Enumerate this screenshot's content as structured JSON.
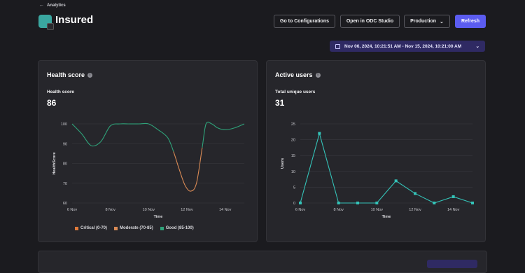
{
  "breadcrumb": {
    "label": "Analytics"
  },
  "header": {
    "title": "Insured",
    "buttons": {
      "configurations": "Go to Configurations",
      "odc_studio": "Open in ODC Studio",
      "environment": "Production",
      "refresh": "Refresh"
    }
  },
  "date_range": "Nov 06, 2024, 10:21:51 AM - Nov 15, 2024, 10:21:00 AM",
  "colors": {
    "accent": "#5b5cf0",
    "good": "#2fa37a",
    "moderate": "#d98a55",
    "critical": "#e07a3a",
    "users_line": "#34c3b8"
  },
  "health_card": {
    "title": "Health score",
    "metric_label": "Health score",
    "metric_value": "86",
    "y_axis_label": "HealthScore",
    "x_axis_label": "Time",
    "legend": [
      "Critical (0-70)",
      "Moderate (70-85)",
      "Good (85-100)"
    ]
  },
  "users_card": {
    "title": "Active users",
    "metric_label": "Total unique users",
    "metric_value": "31",
    "y_axis_label": "Users",
    "x_axis_label": "Time"
  },
  "chart_data": [
    {
      "type": "line",
      "y_ticks": [
        "100",
        "90",
        "80",
        "70",
        "60"
      ],
      "x_ticks": [
        "6 Nov",
        "8 Nov",
        "10 Nov",
        "12 Nov",
        "14 Nov"
      ],
      "ylim": [
        60,
        100
      ],
      "x": [
        6.0,
        6.5,
        7.0,
        7.5,
        8.0,
        8.5,
        9.0,
        9.5,
        10.0,
        10.5,
        11.0,
        11.3,
        11.6,
        11.9,
        12.2,
        12.5,
        12.8,
        13.0,
        13.3,
        13.6,
        14.0,
        14.5,
        15.0
      ],
      "values": [
        100,
        95,
        89,
        91,
        99,
        100,
        100,
        100,
        100,
        97,
        93,
        86,
        77,
        69,
        66,
        70,
        88,
        100,
        100,
        98,
        97,
        98,
        100
      ],
      "grid": true,
      "legend_position": "bottom"
    },
    {
      "type": "line",
      "y_ticks": [
        "25",
        "20",
        "15",
        "10",
        "5",
        "0"
      ],
      "x_ticks": [
        "6 Nov",
        "8 Nov",
        "10 Nov",
        "12 Nov",
        "14 Nov"
      ],
      "ylim": [
        0,
        25
      ],
      "x": [
        6,
        7,
        8,
        9,
        10,
        11,
        12,
        13,
        14,
        15
      ],
      "values": [
        0,
        22,
        0,
        0,
        0,
        7,
        3,
        0,
        2,
        0
      ],
      "grid": true
    }
  ]
}
